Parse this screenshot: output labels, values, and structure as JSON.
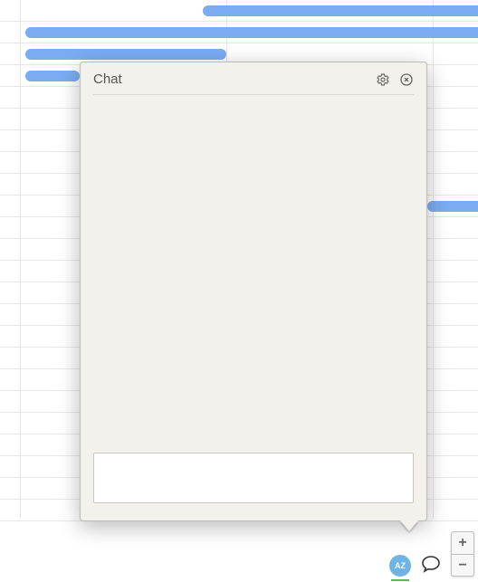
{
  "chat": {
    "title": "Chat",
    "input_value": "",
    "input_placeholder": ""
  },
  "avatar": {
    "initials": "AZ"
  },
  "zoom": {
    "in_label": "+",
    "out_label": "−"
  },
  "icons": {
    "gear": "gear-icon",
    "close": "close-icon",
    "chat": "chat-icon"
  },
  "colors": {
    "bar": "#7bacf2",
    "panel_bg": "#f2f1eb",
    "avatar_bg": "#6fb4e4",
    "presence": "#5fb85f"
  }
}
